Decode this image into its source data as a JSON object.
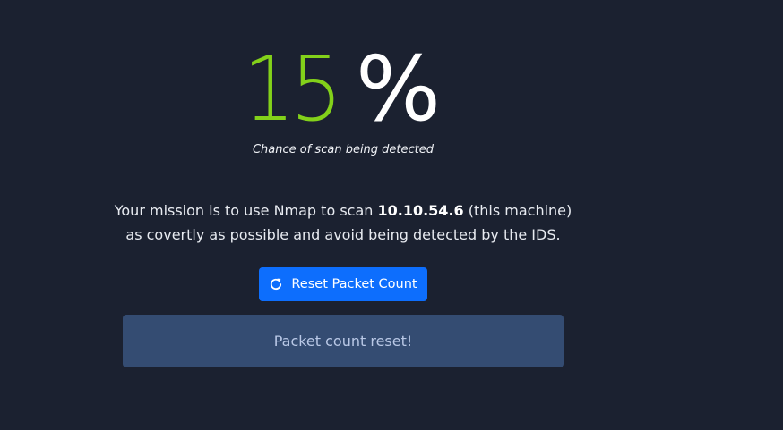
{
  "detection": {
    "value": "15",
    "unit": "%",
    "caption": "Chance of scan being detected"
  },
  "mission": {
    "prefix": "Your mission is to use Nmap to scan ",
    "target_ip": "10.10.54.6",
    "suffix": " (this machine)",
    "line2": "as covertly as possible and avoid being detected by the IDS."
  },
  "reset_button": {
    "label": "Reset Packet Count",
    "icon": "refresh-icon"
  },
  "alert": {
    "message": "Packet count reset!"
  },
  "colors": {
    "background": "#1b2130",
    "percent_value": "#83d11a",
    "button": "#0d6efd",
    "alert_bg": "#344c72"
  }
}
